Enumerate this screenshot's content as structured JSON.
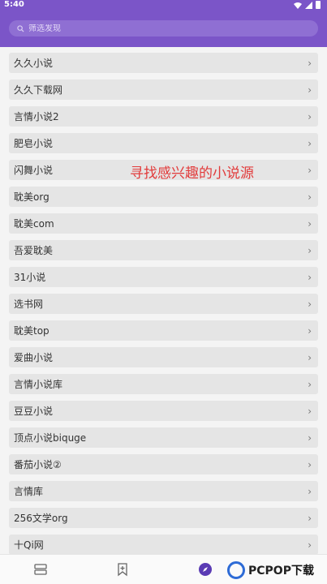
{
  "status": {
    "time": "5:40"
  },
  "search": {
    "placeholder": "筛选发现"
  },
  "sources": [
    "久久小说",
    "久久下载网",
    "言情小说2",
    "肥皂小说",
    "闪舞小说",
    "耽美org",
    "耽美com",
    "吾爱耽美",
    "31小说",
    "选书网",
    "耽美top",
    "爱曲小说",
    "言情小说库",
    "豆豆小说",
    "顶点小说biquge",
    "番茄小说②",
    "言情库",
    "256文学org",
    "十Qi网"
  ],
  "watermark": "寻找感兴趣的小说源",
  "logo": {
    "brand": "PCPOP",
    "suffix": "下载"
  },
  "colors": {
    "accent": "#7b55c8",
    "annotation": "#e23b3b"
  }
}
